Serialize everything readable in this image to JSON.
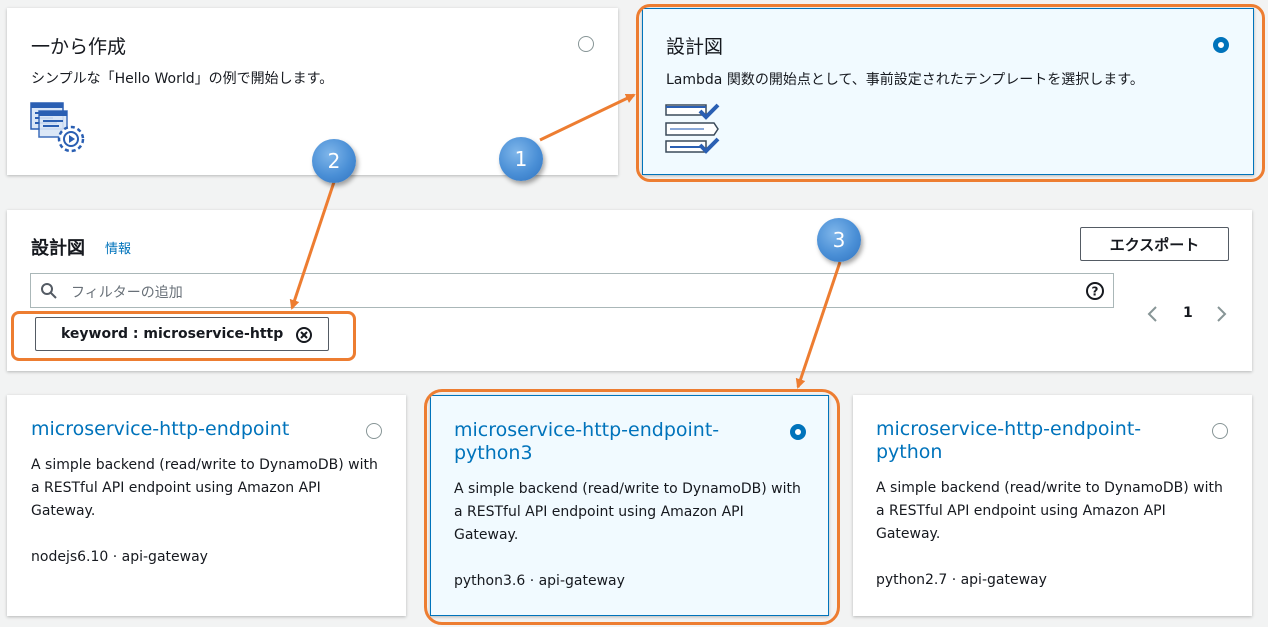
{
  "options": {
    "scratch": {
      "title": "一から作成",
      "desc": "シンプルな「Hello World」の例で開始します。",
      "icon": "code-gear-icon",
      "selected": false
    },
    "blueprint": {
      "title": "設計図",
      "desc": "Lambda 関数の開始点として、事前設定されたテンプレートを選択します。",
      "icon": "checklist-icon",
      "selected": true
    }
  },
  "panel": {
    "title": "設計図",
    "info_link": "情報",
    "export_button": "エクスポート",
    "search_placeholder": "フィルターの追加",
    "filter_token": "keyword : microservice-http",
    "page_number": "1"
  },
  "blueprints": [
    {
      "title": "microservice-http-endpoint",
      "desc": "A simple backend (read/write to DynamoDB) with a RESTful API endpoint using Amazon API Gateway.",
      "tags": "nodejs6.10 · api-gateway",
      "selected": false
    },
    {
      "title": "microservice-http-endpoint-python3",
      "desc": "A simple backend (read/write to DynamoDB) with a RESTful API endpoint using Amazon API Gateway.",
      "tags": "python3.6 · api-gateway",
      "selected": true
    },
    {
      "title": "microservice-http-endpoint-python",
      "desc": "A simple backend (read/write to DynamoDB) with a RESTful API endpoint using Amazon API Gateway.",
      "tags": "python2.7 · api-gateway",
      "selected": false
    }
  ],
  "annotations": [
    "1",
    "2",
    "3"
  ],
  "colors": {
    "accent": "#0073bb",
    "highlight": "#ed7d31",
    "badge": "#4a8fd6"
  }
}
